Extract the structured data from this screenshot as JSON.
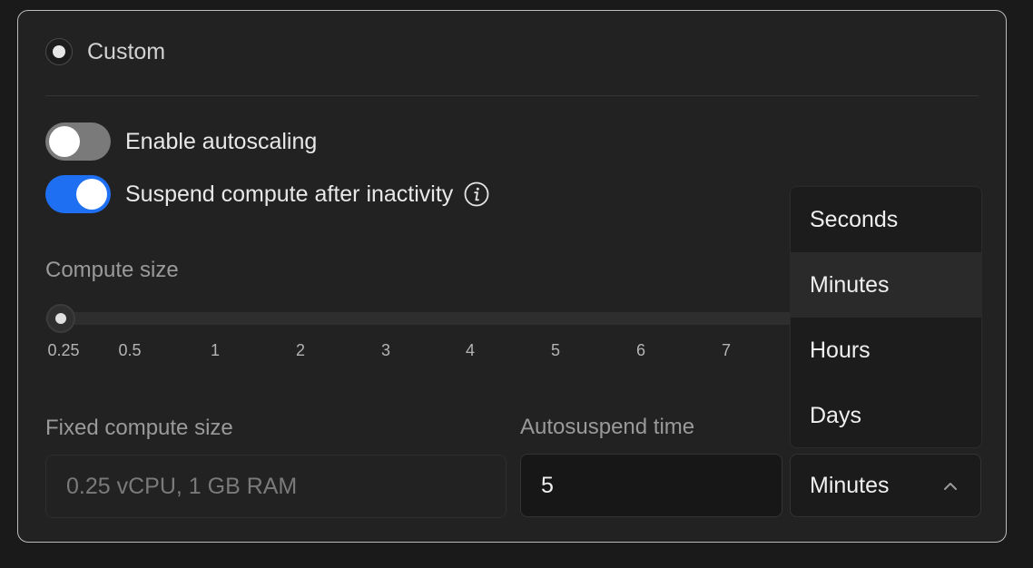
{
  "mode": {
    "label": "Custom"
  },
  "toggles": {
    "autoscaling": {
      "label": "Enable autoscaling",
      "on": false
    },
    "suspend": {
      "label": "Suspend compute after inactivity",
      "on": true
    }
  },
  "compute_size": {
    "label": "Compute size",
    "ticks": [
      "0.25",
      "0.5",
      "1",
      "2",
      "3",
      "4",
      "5",
      "6",
      "7"
    ],
    "selected_value": "0.25"
  },
  "fixed_compute": {
    "label": "Fixed compute size",
    "value": "0.25 vCPU, 1 GB RAM"
  },
  "autosuspend": {
    "label": "Autosuspend time",
    "value": "5",
    "unit": "Minutes",
    "options": [
      "Seconds",
      "Minutes",
      "Hours",
      "Days"
    ],
    "highlighted_option": "Minutes"
  },
  "colors": {
    "accent": "#1e6ff1",
    "background": "#222222"
  }
}
